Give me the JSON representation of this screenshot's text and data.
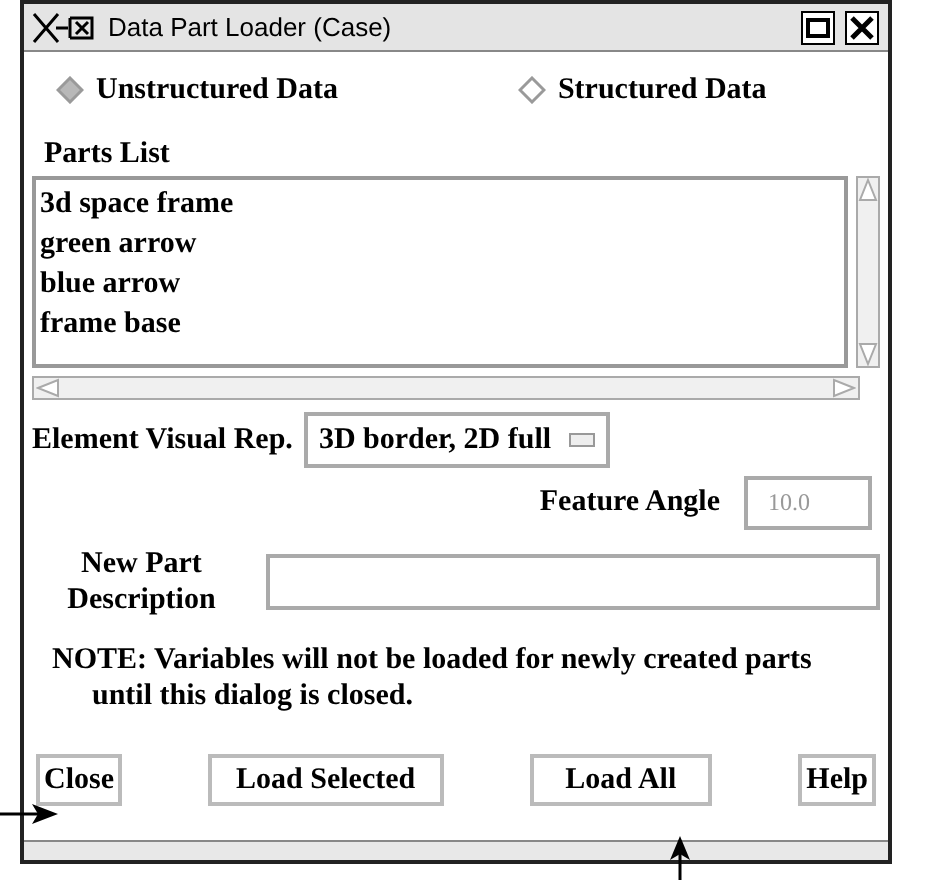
{
  "window": {
    "title": "Data Part Loader (Case)"
  },
  "data_types": [
    {
      "label": "Unstructured Data",
      "selected": true
    },
    {
      "label": "Structured Data",
      "selected": false
    }
  ],
  "parts_list": {
    "label": "Parts List",
    "items": [
      {
        "label": "3d space frame",
        "selected": false
      },
      {
        "label": "green arrow",
        "selected": false
      },
      {
        "label": "blue arrow",
        "selected": false
      },
      {
        "label": "frame base",
        "selected": false
      }
    ]
  },
  "element_visual_rep": {
    "label": "Element Visual Rep.",
    "value": "3D border, 2D full"
  },
  "feature_angle": {
    "label": "Feature Angle",
    "value": "10.0",
    "disabled": true
  },
  "new_part_description": {
    "label": "New Part Description"
  },
  "note": "NOTE: Variables will not be loaded for newly created parts until this dialog is closed.",
  "buttons": [
    "Close",
    "Load Selected",
    "Load All",
    "Help"
  ]
}
